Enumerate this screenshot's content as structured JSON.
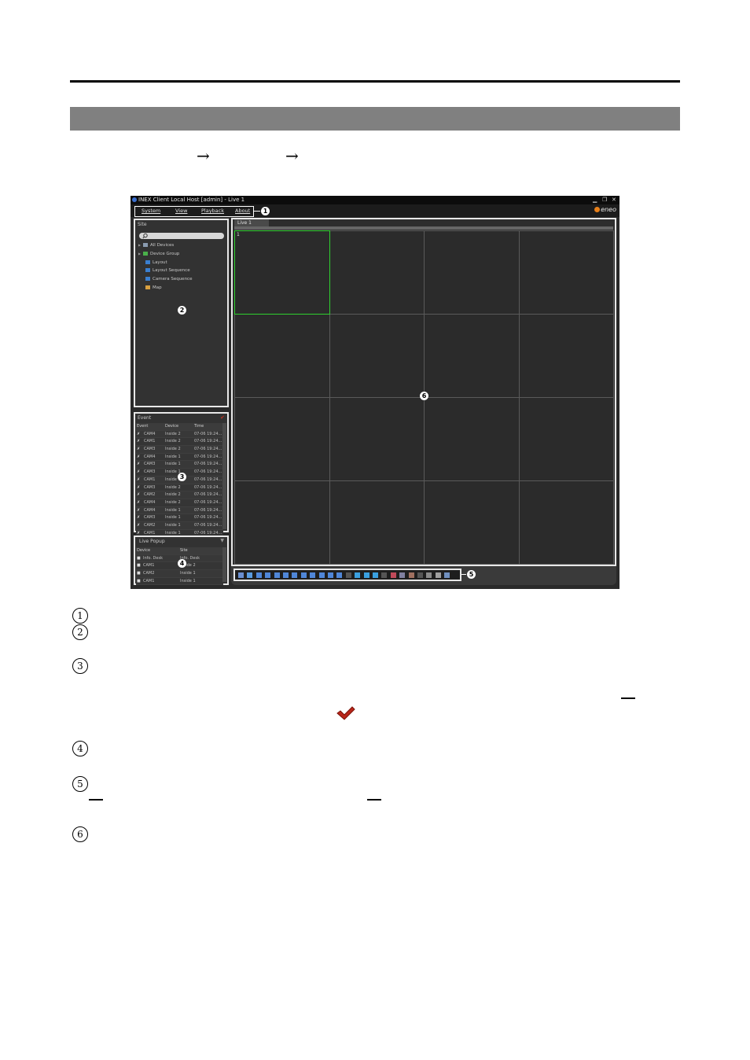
{
  "doc": {
    "arrows": [
      "→",
      "→"
    ],
    "check_icon": "check-mark-icon",
    "numbers": [
      "1",
      "2",
      "3",
      "4",
      "5",
      "6"
    ]
  },
  "window": {
    "title": "INEX Client Local Host [admin] - Live  1",
    "minimize": "▁",
    "restore": "❐",
    "close": "✕",
    "menu": [
      "System",
      "View",
      "Playback",
      "About"
    ],
    "logo": "eneo"
  },
  "site_panel": {
    "title": "Site",
    "tree": [
      {
        "label": "All Devices",
        "expander": "▶",
        "icon": "devices-icon",
        "color": "#8a9bb0"
      },
      {
        "label": "Device Group",
        "expander": "▶",
        "icon": "group-icon",
        "color": "#4ab04a"
      },
      {
        "label": "Layout",
        "expander": "",
        "icon": "layout-icon",
        "color": "#3a7fd0"
      },
      {
        "label": "Layout Sequence",
        "expander": "",
        "icon": "layout-sequence-icon",
        "color": "#3a7fd0"
      },
      {
        "label": "Camera Sequence",
        "expander": "",
        "icon": "camera-sequence-icon",
        "color": "#3a7fd0"
      },
      {
        "label": "Map",
        "expander": "",
        "icon": "map-icon",
        "color": "#d8a040"
      }
    ]
  },
  "event_panel": {
    "title": "Event",
    "columns": [
      "Event",
      "Device",
      "Time"
    ],
    "rows": [
      {
        "event": "CAM4",
        "device": "Inside 2",
        "time": "07-06 19:24..."
      },
      {
        "event": "CAM1",
        "device": "Inside 2",
        "time": "07-06 19:24..."
      },
      {
        "event": "CAM3",
        "device": "Inside 2",
        "time": "07-06 19:24..."
      },
      {
        "event": "CAM4",
        "device": "Inside 1",
        "time": "07-06 19:24..."
      },
      {
        "event": "CAM3",
        "device": "Inside 1",
        "time": "07-06 19:24..."
      },
      {
        "event": "CAM3",
        "device": "Inside 1",
        "time": "07-06 19:24..."
      },
      {
        "event": "CAM1",
        "device": "Inside 1",
        "time": "07-06 19:24..."
      },
      {
        "event": "CAM3",
        "device": "Inside 2",
        "time": "07-06 19:24..."
      },
      {
        "event": "CAM2",
        "device": "Inside 2",
        "time": "07-06 19:24..."
      },
      {
        "event": "CAM4",
        "device": "Inside 2",
        "time": "07-06 19:24..."
      },
      {
        "event": "CAM4",
        "device": "Inside 1",
        "time": "07-06 19:24..."
      },
      {
        "event": "CAM3",
        "device": "Inside 1",
        "time": "07-06 19:24..."
      },
      {
        "event": "CAM2",
        "device": "Inside 1",
        "time": "07-06 19:24..."
      },
      {
        "event": "CAM1",
        "device": "Inside 1",
        "time": "07-06 19:24..."
      }
    ]
  },
  "live_popup_panel": {
    "title": "Live Popup",
    "columns": [
      "Device",
      "Site"
    ],
    "rows": [
      {
        "device": "Info. Desk",
        "site": "Info. Desk"
      },
      {
        "device": "CAM1",
        "site": "Inside 2"
      },
      {
        "device": "CAM2",
        "site": "Inside 1"
      },
      {
        "device": "CAM1",
        "site": "Inside 1"
      }
    ]
  },
  "live_view": {
    "tab_label": "Live  1",
    "selected_cell_number": "1"
  },
  "callouts": [
    "1",
    "2",
    "3",
    "4",
    "5",
    "6"
  ]
}
